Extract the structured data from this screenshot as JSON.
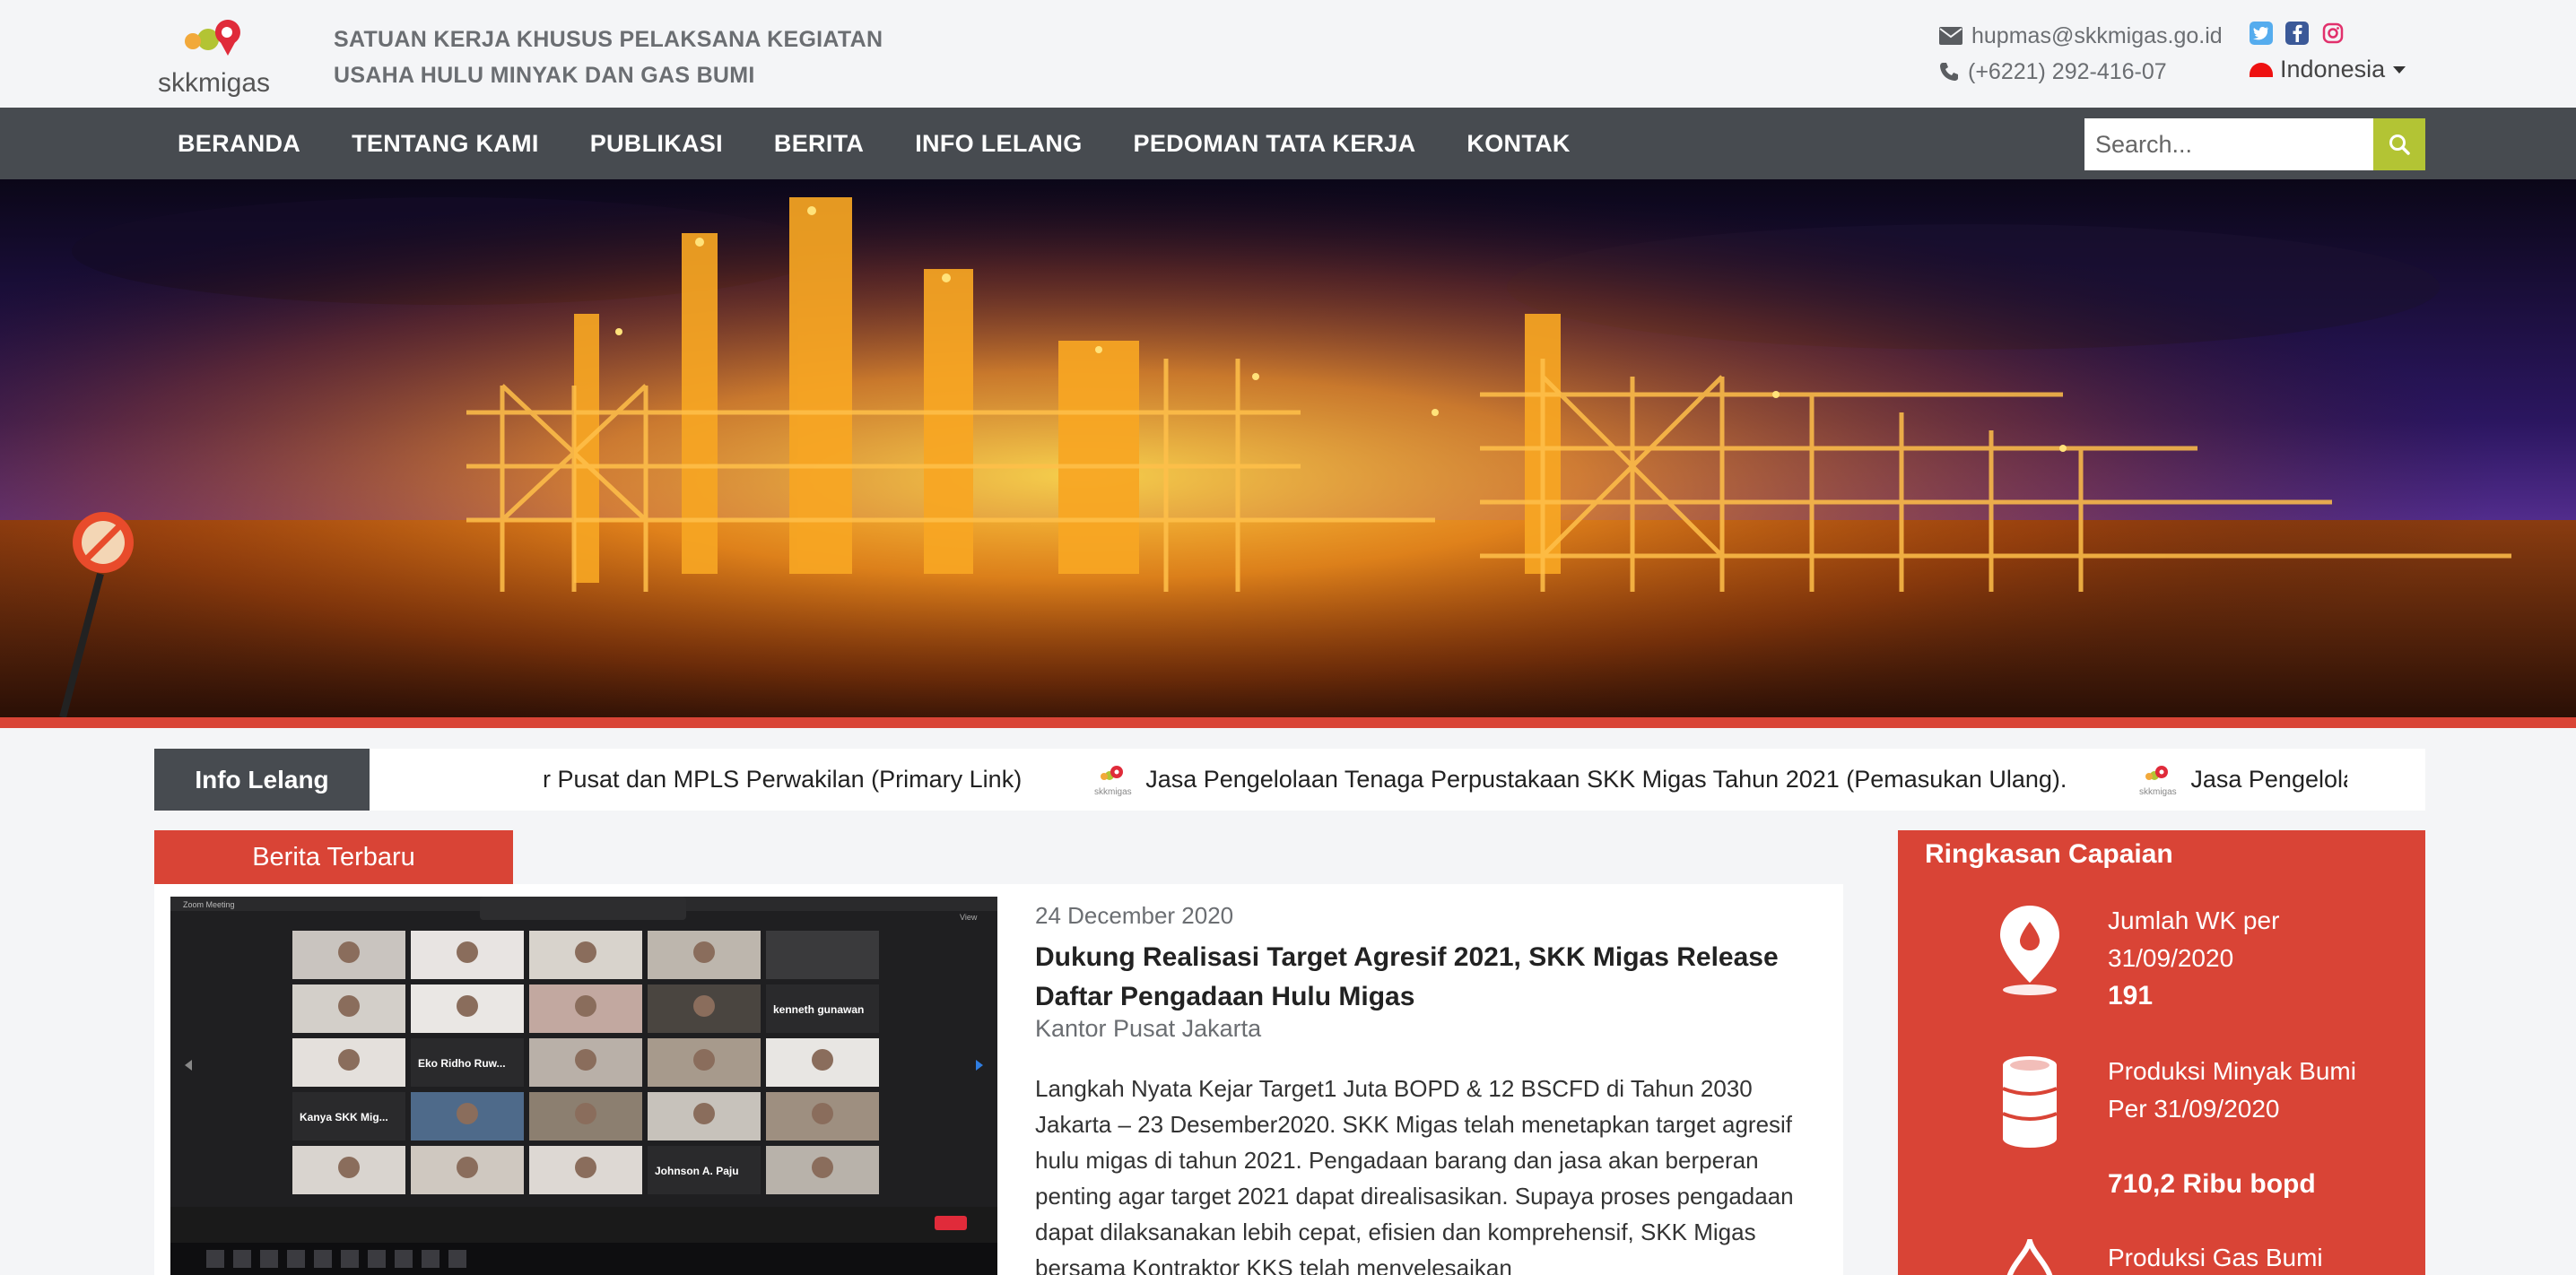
{
  "header": {
    "org_line1": "SATUAN KERJA KHUSUS PELAKSANA KEGIATAN",
    "org_line2": "USAHA HULU MINYAK DAN GAS BUMI",
    "logo_text": "skkmigas",
    "email": "hupmas@skkmigas.go.id",
    "phone": "(+6221) 292-416-07",
    "language": "Indonesia",
    "social": [
      "twitter-icon",
      "facebook-icon",
      "instagram-icon"
    ],
    "colors": {
      "twitter": "#55acee",
      "facebook": "#3b5998",
      "instagram": "#e1306c"
    }
  },
  "nav": {
    "items": [
      "BERANDA",
      "TENTANG KAMI",
      "PUBLIKASI",
      "BERITA",
      "INFO LELANG",
      "PEDOMAN TATA KERJA",
      "KONTAK"
    ],
    "search_placeholder": "Search..."
  },
  "ticker": {
    "label": "Info Lelang",
    "items": [
      "r Pusat dan MPLS Perwakilan (Primary Link)",
      "Jasa Pengelolaan Tenaga Perpustakaan SKK Migas Tahun 2021 (Pemasukan Ulang).",
      "Jasa Pengelolaan Admi"
    ]
  },
  "news": {
    "tab_label": "Berita Terbaru",
    "date": "24 December 2020",
    "title": "Dukung Realisasi Target Agresif 2021, SKK Migas Release Daftar Pengadaan Hulu Migas",
    "location": "Kantor Pusat Jakarta",
    "excerpt": "Langkah Nyata Kejar Target1 Juta BOPD & 12 BSCFD di Tahun 2030 Jakarta – 23 Desember2020. SKK Migas telah menetapkan target agresif hulu migas di tahun 2021. Pengadaan barang dan jasa akan berperan penting agar target 2021 dapat direalisasikan. Supaya proses pengadaan dapat dilaksanakan lebih cepat, efisien dan komprehensif, SKK Migas bersama Kontraktor KKS telah menyelesaikan",
    "image_labels": {
      "top": "Zoom Meeting",
      "view": "View",
      "p1": "kenneth gunawan",
      "p2": "Eko Ridho Ruw...",
      "p3": "Kanya SKK Mig...",
      "p4": "Johnson A. Paju"
    }
  },
  "summary": {
    "title": "Ringkasan Capaian",
    "stats": [
      {
        "label": "Jumlah WK per 31/09/2020",
        "value": "191",
        "icon": "map-pin-drop-icon"
      },
      {
        "label": "Produksi Minyak Bumi Per 31/09/2020",
        "value": "710,2 Ribu bopd",
        "icon": "oil-barrel-icon"
      },
      {
        "label": "Produksi Gas Bumi",
        "value": "",
        "icon": "gas-flame-icon"
      }
    ]
  },
  "colors": {
    "accent": "#d94436",
    "nav": "#474b50",
    "search_button": "#b3c434"
  }
}
